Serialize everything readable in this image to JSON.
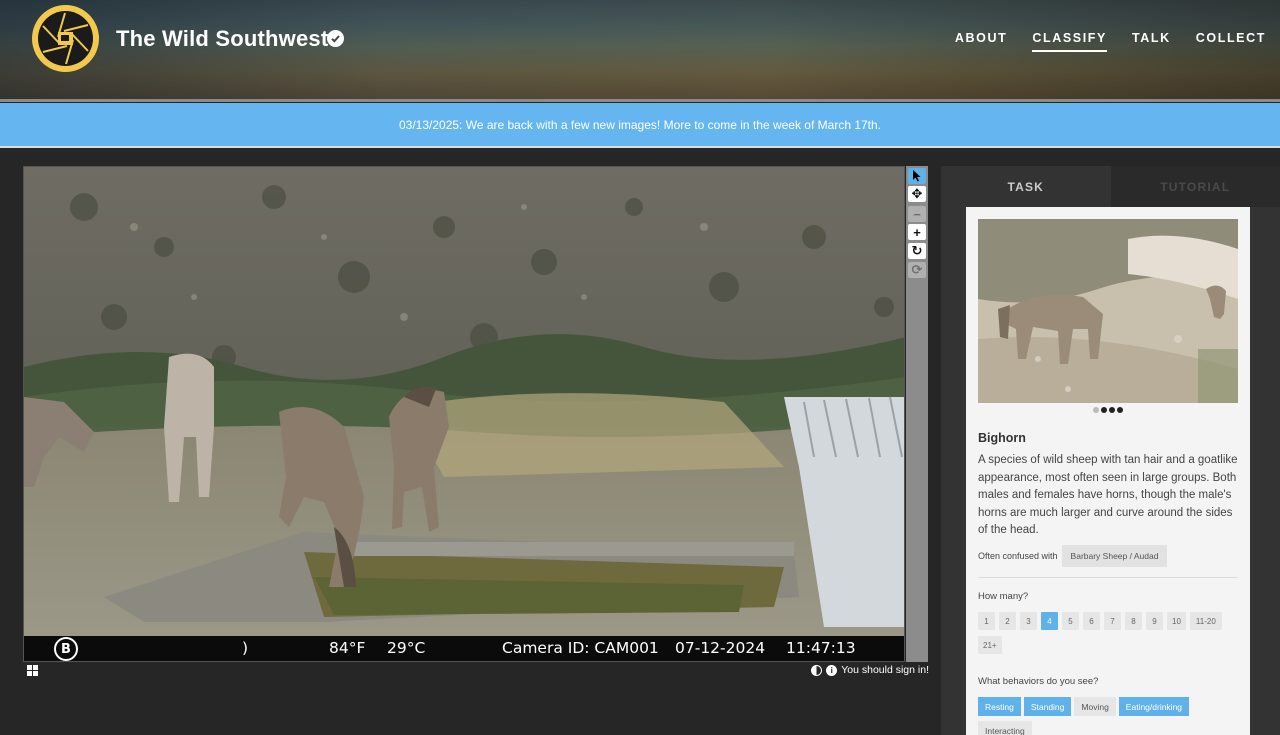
{
  "header": {
    "title": "The Wild Southwest",
    "nav": [
      "ABOUT",
      "CLASSIFY",
      "TALK",
      "COLLECT"
    ],
    "active_nav": "CLASSIFY"
  },
  "banner": {
    "text": "03/13/2025: We are back with a few new images! More to come in the week of March 17th."
  },
  "camera_bar": {
    "brand_letter": "B",
    "moon": ")",
    "temp_f": "84°F",
    "temp_c": "29°C",
    "camera_id": "Camera ID: CAM001",
    "date": "07-12-2024",
    "time": "11:47:13"
  },
  "toolbar": [
    "pointer-icon",
    "move-icon",
    "zoom-out-icon",
    "zoom-in-icon",
    "rotate-icon",
    "reset-icon"
  ],
  "meta": {
    "sign_in": "You should sign in!"
  },
  "tabs": {
    "task": "TASK",
    "tutorial": "TUTORIAL"
  },
  "species": {
    "name": "Bighorn",
    "description": "A species of wild sheep with tan hair and a goatlike appearance, most often seen in large groups. Both males and females have horns, though the male's horns are much larger and curve around the sides of the head.",
    "confused_label": "Often confused with",
    "confused_with": "Barbary Sheep / Audad"
  },
  "how_many": {
    "label": "How many?",
    "options": [
      "1",
      "2",
      "3",
      "4",
      "5",
      "6",
      "7",
      "8",
      "9",
      "10",
      "11-20",
      "21+"
    ],
    "selected": "4"
  },
  "behaviors": {
    "label": "What behaviors do you see?",
    "options": [
      {
        "label": "Resting",
        "selected": true
      },
      {
        "label": "Standing",
        "selected": true
      },
      {
        "label": "Moving",
        "selected": false
      },
      {
        "label": "Eating/drinking",
        "selected": true
      },
      {
        "label": "Interacting",
        "selected": false
      }
    ]
  },
  "colors": {
    "accent": "#5fb1ea",
    "banner": "#65b6f0",
    "logo": "#f2c94c"
  }
}
